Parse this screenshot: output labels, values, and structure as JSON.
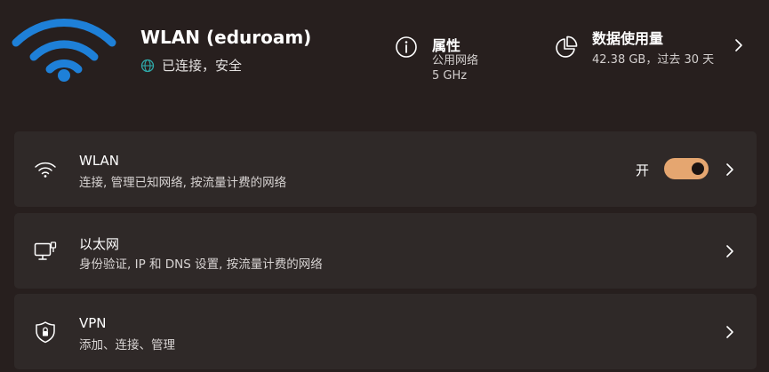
{
  "header": {
    "network_name": "WLAN (eduroam)",
    "status": "已连接，安全",
    "properties": {
      "title": "属性",
      "network_type": "公用网络",
      "band": "5 GHz"
    },
    "data_usage": {
      "title": "数据使用量",
      "detail": "42.38 GB，过去 30 天"
    }
  },
  "cards": [
    {
      "id": "wlan",
      "icon": "wifi-icon",
      "title": "WLAN",
      "subtitle": "连接, 管理已知网络, 按流量计费的网络",
      "toggle_label": "开",
      "toggle_on": true
    },
    {
      "id": "ethernet",
      "icon": "ethernet-icon",
      "title": "以太网",
      "subtitle": "身份验证, IP 和 DNS 设置, 按流量计费的网络"
    },
    {
      "id": "vpn",
      "icon": "shield-icon",
      "title": "VPN",
      "subtitle": "添加、连接、管理"
    }
  ],
  "colors": {
    "background": "#271f1e",
    "card": "#2f2928",
    "wifi_blue": "#1e80d8",
    "accent_toggle": "#e5a670",
    "globe_teal": "#2fa8a8"
  }
}
